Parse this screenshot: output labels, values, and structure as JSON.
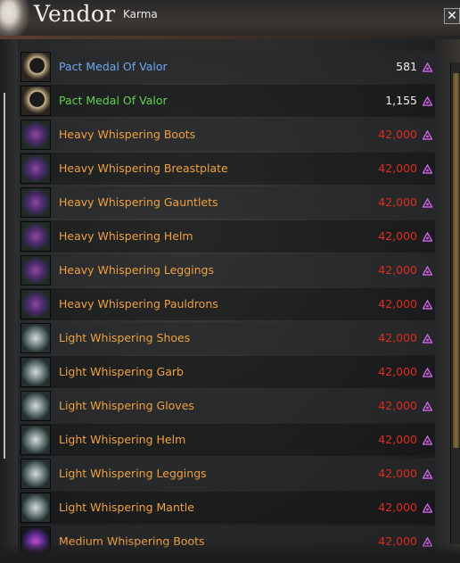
{
  "window": {
    "title": "Vendor",
    "tab": "Karma",
    "close_label": "✕"
  },
  "colors": {
    "blue_item": "#6fa8f0",
    "green_item": "#62d24a",
    "exotic_item": "#f0a040",
    "price_ok": "#f2f2f2",
    "price_unaffordable": "#e02b20",
    "karma_icon": "#c860e0"
  },
  "items": [
    {
      "name": "Pact Medal Of Valor",
      "price": "581",
      "rarity": "blue",
      "affordable": true,
      "icon": "medal-icon"
    },
    {
      "name": "Pact Medal Of Valor",
      "price": "1,155",
      "rarity": "green",
      "affordable": true,
      "icon": "medal-icon"
    },
    {
      "name": "Heavy Whispering Boots",
      "price": "42,000",
      "rarity": "exotic",
      "affordable": false,
      "icon": "heavy-armor-icon"
    },
    {
      "name": "Heavy Whispering Breastplate",
      "price": "42,000",
      "rarity": "exotic",
      "affordable": false,
      "icon": "heavy-armor-icon"
    },
    {
      "name": "Heavy Whispering Gauntlets",
      "price": "42,000",
      "rarity": "exotic",
      "affordable": false,
      "icon": "heavy-armor-icon"
    },
    {
      "name": "Heavy Whispering Helm",
      "price": "42,000",
      "rarity": "exotic",
      "affordable": false,
      "icon": "heavy-armor-icon"
    },
    {
      "name": "Heavy Whispering Leggings",
      "price": "42,000",
      "rarity": "exotic",
      "affordable": false,
      "icon": "heavy-armor-icon"
    },
    {
      "name": "Heavy Whispering Pauldrons",
      "price": "42,000",
      "rarity": "exotic",
      "affordable": false,
      "icon": "heavy-armor-icon"
    },
    {
      "name": "Light Whispering Shoes",
      "price": "42,000",
      "rarity": "exotic",
      "affordable": false,
      "icon": "light-armor-icon"
    },
    {
      "name": "Light Whispering Garb",
      "price": "42,000",
      "rarity": "exotic",
      "affordable": false,
      "icon": "light-armor-icon"
    },
    {
      "name": "Light Whispering Gloves",
      "price": "42,000",
      "rarity": "exotic",
      "affordable": false,
      "icon": "light-armor-icon"
    },
    {
      "name": "Light Whispering Helm",
      "price": "42,000",
      "rarity": "exotic",
      "affordable": false,
      "icon": "light-armor-icon"
    },
    {
      "name": "Light Whispering Leggings",
      "price": "42,000",
      "rarity": "exotic",
      "affordable": false,
      "icon": "light-armor-icon"
    },
    {
      "name": "Light Whispering Mantle",
      "price": "42,000",
      "rarity": "exotic",
      "affordable": false,
      "icon": "light-armor-icon"
    },
    {
      "name": "Medium Whispering Boots",
      "price": "42,000",
      "rarity": "exotic",
      "affordable": false,
      "icon": "medium-armor-icon"
    }
  ]
}
